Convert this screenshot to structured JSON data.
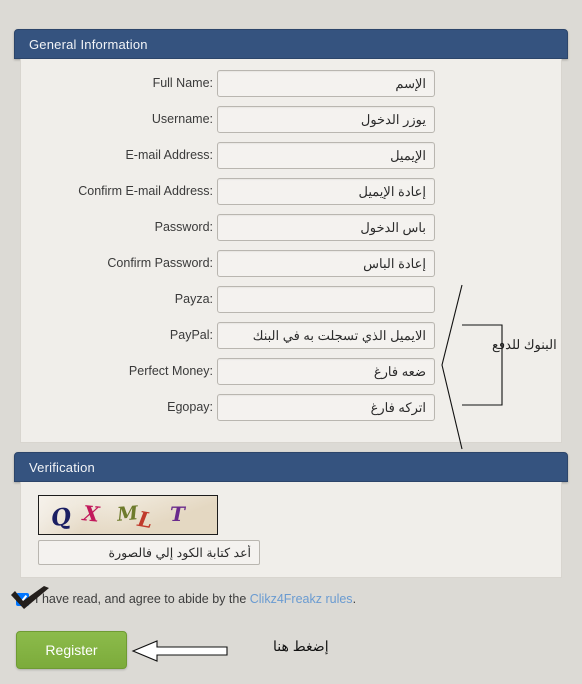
{
  "page": {
    "background_color": "#dcdad5",
    "panel_color": "#f0eeea",
    "header_color": "#35537f",
    "link_color": "#6a9bd1",
    "button_color": "#7fb23f"
  },
  "general_section": {
    "header_title": "General Information",
    "fields": [
      {
        "label": "Full Name:",
        "value": "الإسم",
        "name": "full-name"
      },
      {
        "label": "Username:",
        "value": "يوزر الدخول",
        "name": "username"
      },
      {
        "label": "E-mail Address:",
        "value": "الإيميل",
        "name": "email"
      },
      {
        "label": "Confirm E-mail Address:",
        "value": "إعادة الإيميل",
        "name": "confirm-email"
      },
      {
        "label": "Password:",
        "value": "باس الدخول",
        "name": "password"
      },
      {
        "label": "Confirm Password:",
        "value": "إعادة الباس",
        "name": "confirm-password"
      },
      {
        "label": "Payza:",
        "value": "",
        "name": "payza"
      },
      {
        "label": "PayPal:",
        "value": "الايميل الذي تسجلت به في البنك",
        "name": "paypal"
      },
      {
        "label": "Perfect Money:",
        "value": "ضعه فارغ",
        "name": "perfect-money"
      },
      {
        "label": "Egopay:",
        "value": "اتركه فارغ",
        "name": "egopay"
      }
    ]
  },
  "annotations": {
    "payment_banks_note": "البنوك للدفع",
    "click_here_note": "إضغط هنا"
  },
  "verification_section": {
    "header_title": "Verification",
    "captcha": {
      "text": "QXMLT",
      "characters": [
        {
          "char": "Q",
          "color": "#1b1f63"
        },
        {
          "char": "X",
          "color": "#c2185b"
        },
        {
          "char": "M",
          "color": "#6e7b2c"
        },
        {
          "char": "L",
          "color": "#c0392b"
        },
        {
          "char": "T",
          "color": "#6a2a8c"
        }
      ]
    },
    "captcha_input_value": "أعد كتابة الكود إلي فالصورة"
  },
  "agreement": {
    "text_before": "I have read, and agree to abide by the ",
    "link_label": "Clikz4Freakz rules",
    "text_after": ".",
    "checked": true
  },
  "register": {
    "label": "Register"
  }
}
